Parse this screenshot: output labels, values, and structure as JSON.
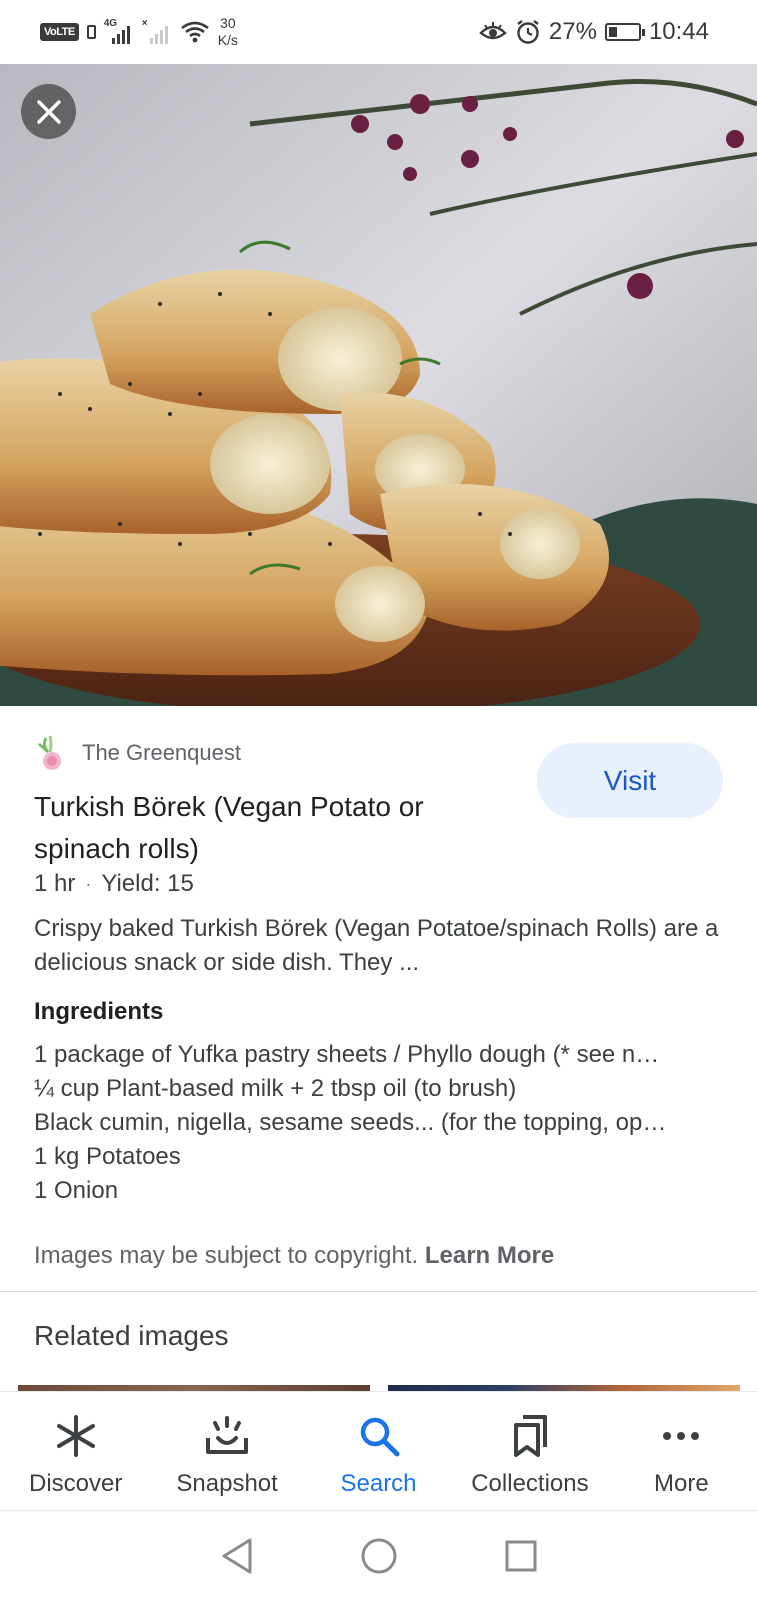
{
  "status_bar": {
    "volte": "VoLTE",
    "network_tag": "4G",
    "speed_value": "30",
    "speed_unit": "K/s",
    "battery": "27%",
    "battery_level": 0.27,
    "time": "10:44"
  },
  "result": {
    "source": "The Greenquest",
    "visit_label": "Visit",
    "title": "Turkish Börek (Vegan Potato or spinach rolls)",
    "time": "1 hr",
    "separator": "·",
    "yield": "Yield: 15",
    "description": "Crispy baked Turkish Börek (Vegan Potatoe/spinach Rolls) are a delicious snack or side dish. They ...",
    "ingredients_heading": "Ingredients",
    "ingredients": [
      "1 package of Yufka pastry sheets / Phyllo dough (* see n…",
      "¼ cup Plant-based milk + 2 tbsp oil (to brush)",
      "Black cumin, nigella, sesame seeds... (for the topping, op…",
      "1 kg Potatoes",
      "1 Onion"
    ],
    "copyright_text": "Images may be subject to copyright.",
    "learn_more": "Learn More",
    "related_heading": "Related images"
  },
  "bottom_nav": {
    "items": [
      {
        "label": "Discover",
        "icon": "asterisk-icon",
        "active": false
      },
      {
        "label": "Snapshot",
        "icon": "snapshot-icon",
        "active": false
      },
      {
        "label": "Search",
        "icon": "search-icon",
        "active": true
      },
      {
        "label": "Collections",
        "icon": "collections-icon",
        "active": false
      },
      {
        "label": "More",
        "icon": "more-icon",
        "active": false
      }
    ]
  },
  "colors": {
    "accent": "#1a73e8",
    "visit_bg": "#e8f0fe",
    "visit_text": "#1a57c5"
  }
}
